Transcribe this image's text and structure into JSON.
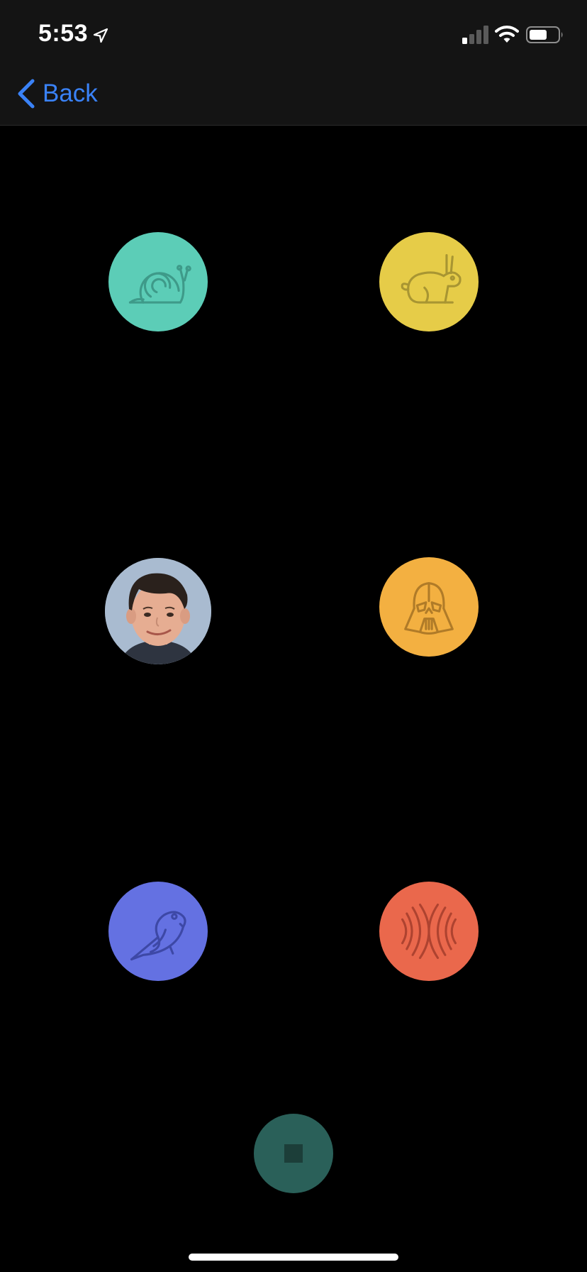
{
  "status_bar": {
    "time": "5:53",
    "icons": [
      "location-arrow-icon",
      "cellular-signal-icon",
      "wifi-icon",
      "battery-icon"
    ]
  },
  "nav": {
    "back_label": "Back",
    "back_icon": "chevron-left-icon",
    "accent_color": "#3a82f7"
  },
  "voice_effects": [
    {
      "name": "snail",
      "icon": "snail-icon",
      "color": "#5ccdb7"
    },
    {
      "name": "rabbit",
      "icon": "rabbit-icon",
      "color": "#e6cc48"
    },
    {
      "name": "photo",
      "icon": "avatar-photo"
    },
    {
      "name": "darth-vader",
      "icon": "darth-vader-icon",
      "color": "#f3b041"
    },
    {
      "name": "parrot",
      "icon": "parrot-icon",
      "color": "#6471e2"
    },
    {
      "name": "echo",
      "icon": "echo-icon",
      "color": "#ea684c"
    }
  ],
  "stop_button": {
    "icon": "stop-icon",
    "color": "#2a6059"
  }
}
